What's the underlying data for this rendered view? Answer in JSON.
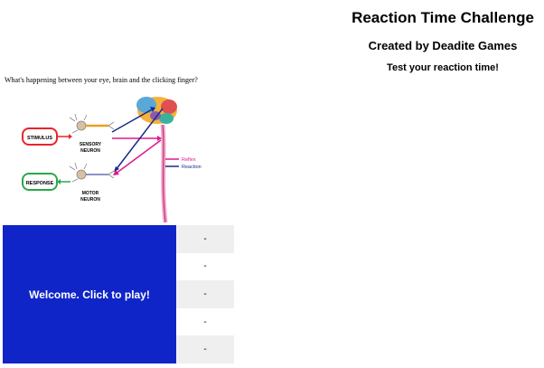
{
  "header": {
    "title": "Reaction Time Challenge",
    "subtitle": "Created by Deadite Games",
    "tagline": "Test your reaction time!"
  },
  "intro": {
    "question": "What's happening between your eye, brain and the clicking finger?"
  },
  "diagram": {
    "stimulus_label": "STIMULUS",
    "response_label": "RESPONSE",
    "sensory_label_1": "SENSORY",
    "sensory_label_2": "NEURON",
    "motor_label_1": "MOTOR",
    "motor_label_2": "NEURON",
    "legend_reflex": "Reflex",
    "legend_reaction": "Reaction",
    "colors": {
      "stimulus": "#e8242a",
      "response": "#2aa84a",
      "reflex": "#e0188c",
      "reaction": "#1a2a8c"
    }
  },
  "game": {
    "play_label": "Welcome. Click to play!",
    "play_bg": "#1025c8"
  },
  "results": [
    "-",
    "-",
    "-",
    "-",
    "-"
  ]
}
